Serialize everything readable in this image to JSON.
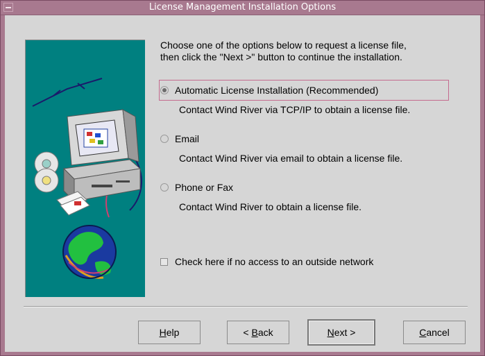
{
  "window": {
    "title": "License Management Installation Options"
  },
  "instructions": {
    "line1": "Choose one of the options below to request a license file,",
    "line2": "then click the \"Next >\" button to continue the installation."
  },
  "options": [
    {
      "label": "Automatic License Installation (Recommended)",
      "description": "Contact Wind River via TCP/IP to obtain a license file.",
      "selected": true
    },
    {
      "label": "Email",
      "description": "Contact Wind River via email to obtain a license file.",
      "selected": false
    },
    {
      "label": "Phone or Fax",
      "description": "Contact Wind River to obtain a license file.",
      "selected": false
    }
  ],
  "checkbox": {
    "label": "Check here if no access to an outside network",
    "checked": false
  },
  "buttons": {
    "help_prefix": "",
    "help_mnemonic": "H",
    "help_rest": "elp",
    "back_prefix": "< ",
    "back_mnemonic": "B",
    "back_rest": "ack",
    "next_prefix": "",
    "next_mnemonic": "N",
    "next_rest": "ext >",
    "cancel_prefix": "",
    "cancel_mnemonic": "C",
    "cancel_rest": "ancel"
  },
  "colors": {
    "titlebar": "#a8798f",
    "image_background": "#008080",
    "focus_border": "#c46a8e"
  }
}
